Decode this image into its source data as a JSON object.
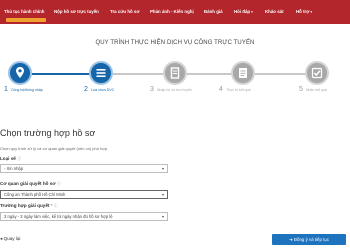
{
  "nav": {
    "items": [
      {
        "label": "Thủ tục hành chính",
        "has_caret": false
      },
      {
        "label": "Nộp hồ sơ trực tuyến",
        "has_caret": false
      },
      {
        "label": "Tra cứu hồ sơ",
        "has_caret": false
      },
      {
        "label": "Phản ánh - Kiến nghị",
        "has_caret": false
      },
      {
        "label": "Đánh giá",
        "has_caret": false
      },
      {
        "label": "Hỏi đáp",
        "has_caret": true
      },
      {
        "label": "Khảo sát",
        "has_caret": false
      },
      {
        "label": "Hỗ trợ",
        "has_caret": true
      }
    ],
    "caret": "▾",
    "bar_color": "#b3262b",
    "active_indicator_color": "#f0a22e"
  },
  "page": {
    "title": "QUY TRÌNH THỰC HIỆN DỊCH VỤ CÔNG TRỰC TUYẾN"
  },
  "stepper": {
    "active_color": "#1565a8",
    "inactive_color": "#a8a8a8",
    "steps": [
      {
        "number": "1",
        "label": "Công bộ/thông nhập",
        "icon": "map-pin-icon",
        "active": true
      },
      {
        "number": "2",
        "label": "Lựa chọn DVC",
        "icon": "list-icon",
        "active": true
      },
      {
        "number": "3",
        "label": "Nhập hồ sơ trực tuyến",
        "icon": "document-icon",
        "active": false
      },
      {
        "number": "4",
        "label": "Thực trị kết quả",
        "icon": "report-icon",
        "active": false
      },
      {
        "number": "5",
        "label": "Nhận kết quả",
        "icon": "check-icon",
        "active": false
      }
    ]
  },
  "form": {
    "title": "Chọn trường hợp hồ sơ",
    "hint": "Chọn quy trình xử lý và cơ quan giải quyết (nếu có) phù hợp.",
    "fields": [
      {
        "label": "Loại sẽ",
        "required": false,
        "help": "ⓘ",
        "value": "- Xin nhập"
      },
      {
        "label": "Cơ quan giải quyết hồ sơ",
        "required": false,
        "help": "ⓘ",
        "value": "Công an Thành phố Hồ Chí Minh"
      },
      {
        "label": "Trường hợp giải quyết",
        "required": true,
        "help": "ⓘ",
        "value": "3 ngày - 3 ngày làm việc, kể từ ngày nhận đủ hồ sơ hợp lệ"
      }
    ],
    "required_mark": "*",
    "caret": "▾"
  },
  "footer": {
    "back_label": "Quay lại",
    "back_icon": "arrow-left-icon",
    "next_label": "Đồng ý và tiếp tục",
    "next_icon": "arrow-right-icon",
    "next_color": "#1e73be"
  }
}
